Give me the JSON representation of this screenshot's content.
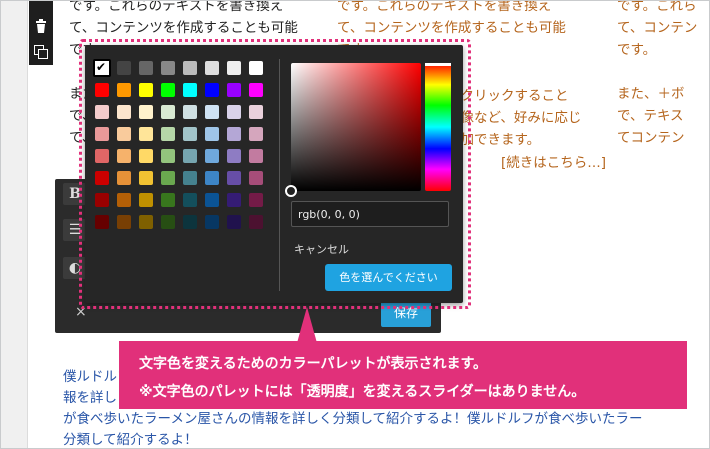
{
  "background": {
    "col1": "です。これらのテキストを書き換え\nて、コンテンツを作成することも可能\nです。\n\nまた、\nで、\nて、",
    "col2": "です。これらのテキストを書き換え\nて、コンテンツを作成することも可能\nです。",
    "col3": "です。これら\nて、コンテン\nです。\n\nまた、＋ボ\nで、テキス\nてコンテン",
    "middle": "をクリックすること\n画像など、好みに応じ\n追加できます。",
    "read_more": "[続きはこちら…]",
    "bottom": "僕ルドルフが食べ歩いたラーメン屋さんの情報を詳しく分類して紹介するよ！僕ルドルフが食べ\n報を詳しく分類して紹介するよ！僕ルドルフが食べ歩いたラーメン屋さんの情報を詳しく分類し\nが食べ歩いたラーメン屋さんの情報を詳しく分類して紹介するよ！僕ルドルフが食べ歩いたラー\n分類して紹介するよ！"
  },
  "toolbar": {
    "trash_icon": "trash-icon",
    "copy_icon": "copy-icon"
  },
  "editor": {
    "bold_label": "B",
    "align_icon": "☰",
    "palette_icon": "◐",
    "close_label": "×",
    "save_label": "保存"
  },
  "picker": {
    "swatches": [
      [
        "#ffffff",
        "#444444",
        "#666666",
        "#888888",
        "#bbbbbb",
        "#dddddd",
        "#eeeeee",
        "#ffffff"
      ],
      [
        "#ff0000",
        "#ff9900",
        "#ffff00",
        "#00ff00",
        "#00ffff",
        "#0000ff",
        "#9900ff",
        "#ff00ff"
      ],
      [
        "#f4cccc",
        "#fce5cd",
        "#fff2cc",
        "#d9ead3",
        "#d0e0e3",
        "#cfe2f3",
        "#d9d2e9",
        "#ead1dc"
      ],
      [
        "#ea9999",
        "#f9cb9c",
        "#ffe599",
        "#b6d7a8",
        "#a2c4c9",
        "#9fc5e8",
        "#b4a7d6",
        "#d5a6bd"
      ],
      [
        "#e06666",
        "#f6b26b",
        "#ffd966",
        "#93c47d",
        "#76a5af",
        "#6fa8dc",
        "#8e7cc3",
        "#c27ba0"
      ],
      [
        "#cc0000",
        "#e69138",
        "#f1c232",
        "#6aa84f",
        "#45818e",
        "#3d85c6",
        "#674ea7",
        "#a64d79"
      ],
      [
        "#990000",
        "#b45f06",
        "#bf9000",
        "#38761d",
        "#134f5c",
        "#0b5394",
        "#351c75",
        "#741b47"
      ],
      [
        "#660000",
        "#783f04",
        "#7f6000",
        "#274e13",
        "#0c343d",
        "#073763",
        "#20124d",
        "#4c1130"
      ]
    ],
    "selected_mark": "✔",
    "value": "rgb(0, 0, 0)",
    "cancel_label": "キャンセル",
    "choose_label": "色を選んでください"
  },
  "annotation": {
    "line1": "文字色を変えるためのカラーパレットが表示されます。",
    "line2": "※文字色のパレットには「透明度」を変えるスライダーはありません。"
  }
}
